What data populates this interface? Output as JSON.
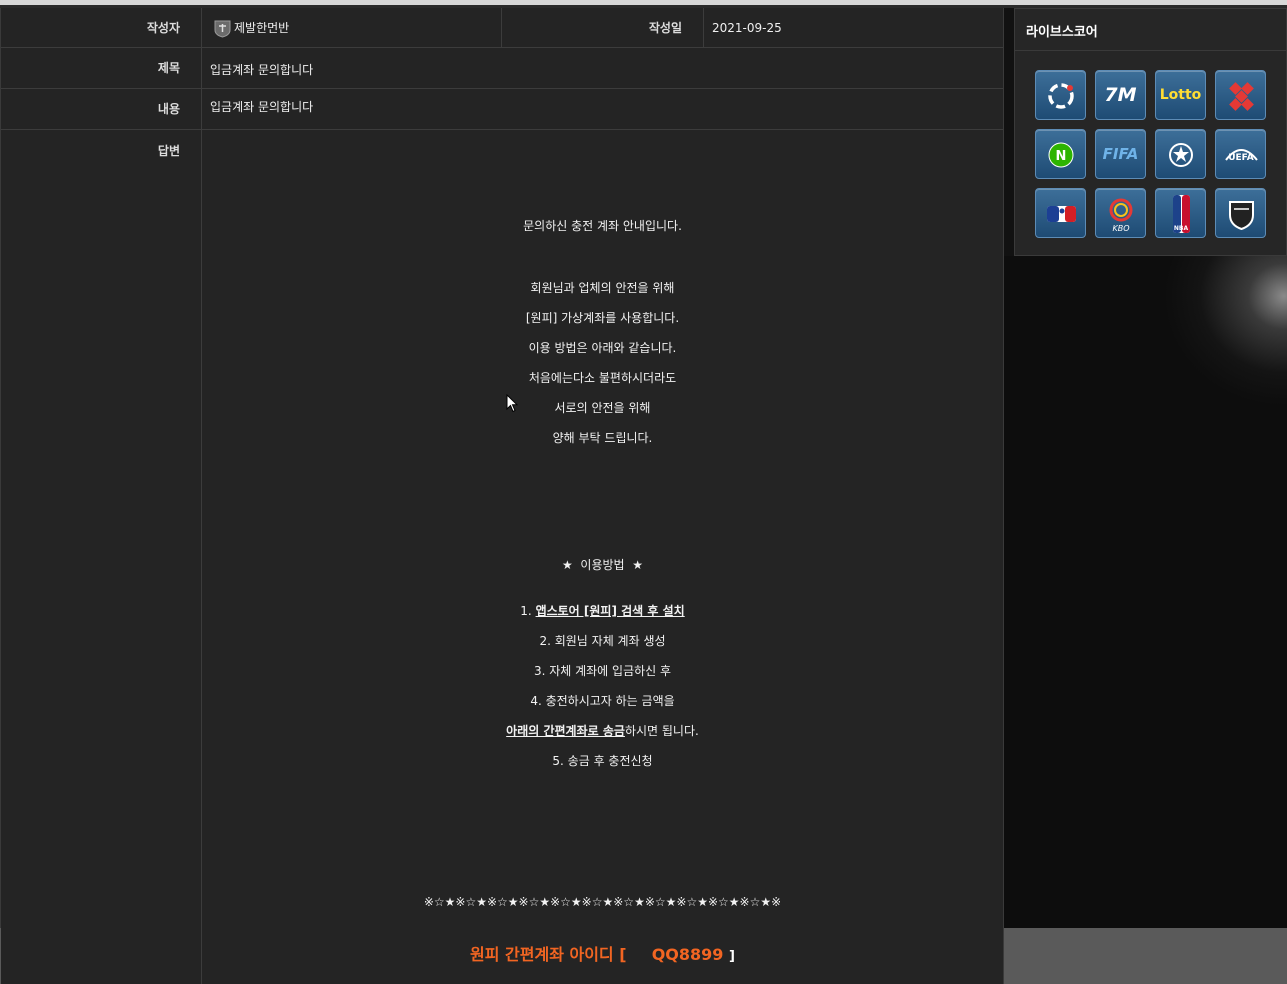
{
  "post": {
    "author_label": "작성자",
    "author_name": "제발한먼반",
    "date_label": "작성일",
    "date": "2021-09-25",
    "title_label": "제목",
    "title": "입금계좌 문의합니다",
    "content_label": "내용",
    "content": "입금계좌 문의합니다",
    "answer_label": "답변"
  },
  "answer": {
    "intro": "문의하신 충전 계좌 안내입니다.",
    "lines": [
      "회원님과 업체의 안전을 위해",
      "[원피] 가상계좌를 사용합니다.",
      "이용 방법은 아래와 같습니다.",
      "처음에는다소 불편하시더라도",
      "서로의 안전을 위해",
      "양해 부탁 드립니다."
    ],
    "howto_title": "★  이용방법  ★",
    "step1_prefix": "1. ",
    "step1_link": "앱스토어 [원피] 검색 후 설치",
    "step2": "2. 회원님 자체 계좌 생성",
    "step3": "3. 자체 계좌에 입금하신 후",
    "step4": "4. 충전하시고자 하는 금액을",
    "step4b_link": "아래의 간편계좌로 송금",
    "step4b_suffix": "하시면 됩니다.",
    "step5": "5. 송금 후 충전신청",
    "stars": "※☆★※☆★※☆★※☆★※☆★※☆★※☆★※☆★※☆★※☆★※☆★※",
    "account_label": "원피 간편계좌 아이디 [",
    "account_id": "QQ8899",
    "account_close": "]"
  },
  "livescore": {
    "title": "라이브스코어",
    "tiles": [
      {
        "name": "livescore-icon"
      },
      {
        "name": "7m-icon",
        "text": "7M"
      },
      {
        "name": "lotto-icon",
        "text": "Lotto"
      },
      {
        "name": "cross-icon"
      },
      {
        "name": "naver-icon",
        "text": "N"
      },
      {
        "name": "fifa-icon",
        "text": "FIFA"
      },
      {
        "name": "champions-league-icon"
      },
      {
        "name": "uefa-icon",
        "text": "UEFA"
      },
      {
        "name": "mlb-icon"
      },
      {
        "name": "kbo-icon",
        "text": "KBO"
      },
      {
        "name": "nba-icon",
        "text": "NBA"
      },
      {
        "name": "nhl-icon"
      }
    ]
  },
  "colors": {
    "accent_orange": "#f26522",
    "tile_blue": "#2d5f8a"
  }
}
